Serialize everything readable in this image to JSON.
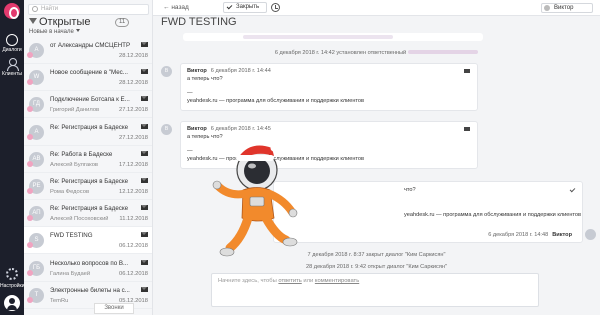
{
  "rail": {
    "dialogs_label": "Диалоги",
    "clients_label": "Клиенты",
    "settings_label": "Настройки"
  },
  "list": {
    "search_placeholder": "Найти",
    "heading": "Открытые",
    "count": "11",
    "sort_label": "Новые в начале",
    "consultants_label": "Звонки",
    "rows": [
      {
        "initials": "А",
        "title": "от Александры СМСЦЕНТР",
        "sub": "",
        "date": "28.12.2018"
      },
      {
        "initials": "W",
        "title": "Новое сообщение в \"Мес...",
        "sub": "",
        "date": "28.12.2018"
      },
      {
        "initials": "ГД",
        "title": "Подключение Ботсапа к Е...",
        "sub": "Григорий Данилов",
        "date": "27.12.2018"
      },
      {
        "initials": "A",
        "title": "Re: Регистрация в Бадеске",
        "sub": "",
        "date": "27.12.2018"
      },
      {
        "initials": "AB",
        "title": "Re: Работа в Бадеске",
        "sub": "Алексей Булгаков",
        "date": "17.12.2018"
      },
      {
        "initials": "РЕ",
        "title": "Re: Регистрация в Бадеске",
        "sub": "Рома Федосов",
        "date": "12.12.2018"
      },
      {
        "initials": "АП",
        "title": "Re: Регистрация в Бадеске",
        "sub": "Алексей Посоховский",
        "date": "11.12.2018"
      },
      {
        "initials": "S",
        "title": "FWD TESTING",
        "sub": "",
        "date": "06.12.2018"
      },
      {
        "initials": "ГБ",
        "title": "Несколько вопросов по В...",
        "sub": "Галина Будаей",
        "date": "06.12.2018"
      },
      {
        "initials": "T",
        "title": "Электронные билеты на с...",
        "sub": "TemRu",
        "date": "05.12.2018"
      }
    ]
  },
  "topbar": {
    "back_label": "назад",
    "close_label": "Закрыть",
    "agent_label": "Виктор"
  },
  "chat": {
    "title": "FWD TESTING",
    "sys1": "6 декабря 2018 г. 14:42 установлен ответственный",
    "msg1": {
      "initials": "В",
      "author": "Виктор",
      "when": "6 декабря 2018 г. 14:44",
      "text": "а теперь что?",
      "dash": "—",
      "sig": "yeahdesk.ru — программа для обслуживания и поддержки клиентов"
    },
    "msg2": {
      "initials": "В",
      "author": "Виктор",
      "when": "6 декабря 2018 г. 14:45",
      "text": "а теперь что?",
      "dash": "—",
      "sig": "yeahdesk.ru — программа для обслуживания и поддержки клиентов"
    },
    "msg3": {
      "text": "что?",
      "sig": "yeahdesk.ru — программа для обслуживания и поддержки клиентов",
      "when": "6 декабря 2018 г. 14:48",
      "author": "Виктор"
    },
    "sys2": "7 декабря 2018 г. 8:37 закрыт диалог \"Ким Саркисян\"",
    "sys3": "28 декабря 2018 г. 9:42 открыт диалог \"Ким Саркисян\"",
    "reply": {
      "pre": "Начните здесь, чтобы",
      "link1": "ответить",
      "mid": "или",
      "link2": "комментировать"
    }
  }
}
